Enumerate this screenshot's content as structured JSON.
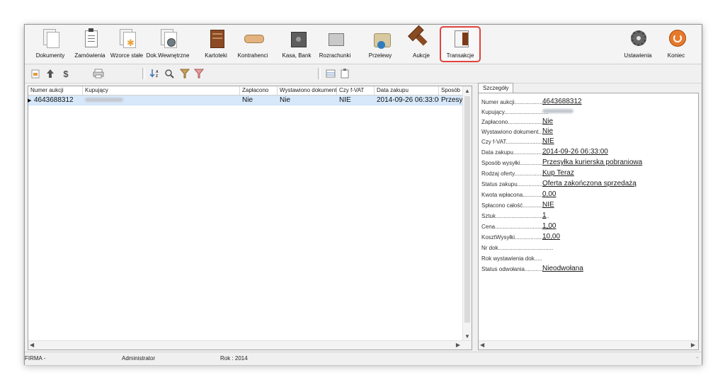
{
  "ribbon": {
    "items": [
      {
        "id": "dokumenty",
        "label": "Dokumenty",
        "icon": "documents-icon"
      },
      {
        "id": "zamowienia",
        "label": "Zamówienia",
        "icon": "clipboard-icon"
      },
      {
        "id": "wzorce",
        "label": "Wzorce stałe",
        "icon": "template-icon"
      },
      {
        "id": "dokwew",
        "label": "Dok.Wewnętrzne",
        "icon": "internal-doc-icon"
      },
      {
        "id": "kartoteki",
        "label": "Kartoteki",
        "icon": "cabinet-icon"
      },
      {
        "id": "kontrahenci",
        "label": "Kontrahenci",
        "icon": "handshake-icon"
      },
      {
        "id": "kasa",
        "label": "Kasa, Bank",
        "icon": "safe-icon"
      },
      {
        "id": "rozrachunki",
        "label": "Rozrachunki",
        "icon": "calculator-icon"
      },
      {
        "id": "przelewy",
        "label": "Przelewy",
        "icon": "money-icon"
      },
      {
        "id": "aukcje",
        "label": "Aukcje",
        "icon": "gavel-icon"
      },
      {
        "id": "transakcje",
        "label": "Transakcje",
        "icon": "transactions-icon",
        "active": true
      },
      {
        "id": "ustawienia",
        "label": "Ustawienia",
        "icon": "gear-icon"
      },
      {
        "id": "koniec",
        "label": "Koniec",
        "icon": "power-icon"
      }
    ],
    "active_border_color": "#e0433c"
  },
  "toolbar": {
    "dollar": "$"
  },
  "grid": {
    "columns": [
      "Numer aukcji",
      "Kupujący",
      "Zapłacono",
      "Wystawiono dokument",
      "Czy f-VAT",
      "Data zakupu",
      "Sposób"
    ],
    "rows": [
      {
        "numer": "4643688312",
        "kupujacy": "",
        "zaplacono": "Nie",
        "wystawiono": "Nie",
        "fvat": "NIE",
        "data": "2014-09-26 06:33:00",
        "sposob": "Przesy"
      }
    ],
    "selected_row_color": "#d6e8fa"
  },
  "details": {
    "tab": "Szczegóły",
    "fields": [
      {
        "label": "Numer aukcji....................",
        "value": "4643688312"
      },
      {
        "label": "Kupujący............................",
        "value": ""
      },
      {
        "label": "Zapłacono.........................",
        "value": "Nie"
      },
      {
        "label": "Wystawiono dokument...",
        "value": "Nie"
      },
      {
        "label": "Czy f-VAT..........................",
        "value": "NIE"
      },
      {
        "label": "Data zakupu......................",
        "value": "2014-09-26 06:33:00"
      },
      {
        "label": "Sposób wysyłki..............",
        "value": "Przesyłka kurierska pobraniowa"
      },
      {
        "label": "Rodzaj oferty...................",
        "value": "Kup Teraz"
      },
      {
        "label": "Status zakupu..................",
        "value": "Oferta zakończona sprzedażą"
      },
      {
        "label": "Kwota wpłacona..............",
        "value": "0,00"
      },
      {
        "label": "Spłacono całość..............",
        "value": "NIE"
      },
      {
        "label": "Sztuk..................................",
        "value": "1"
      },
      {
        "label": "Cena....................................",
        "value": "1,00"
      },
      {
        "label": "KosztWysyłki....................",
        "value": "10,00"
      },
      {
        "label": "Nr dok...................................",
        "value": ""
      },
      {
        "label": "Rok wystawienia dok.....",
        "value": ""
      },
      {
        "label": "Status odwołania............",
        "value": "Nieodwołana"
      }
    ]
  },
  "status": {
    "firma": "FIRMA -",
    "user": "Administrator",
    "rok": "Rok : 2014"
  }
}
